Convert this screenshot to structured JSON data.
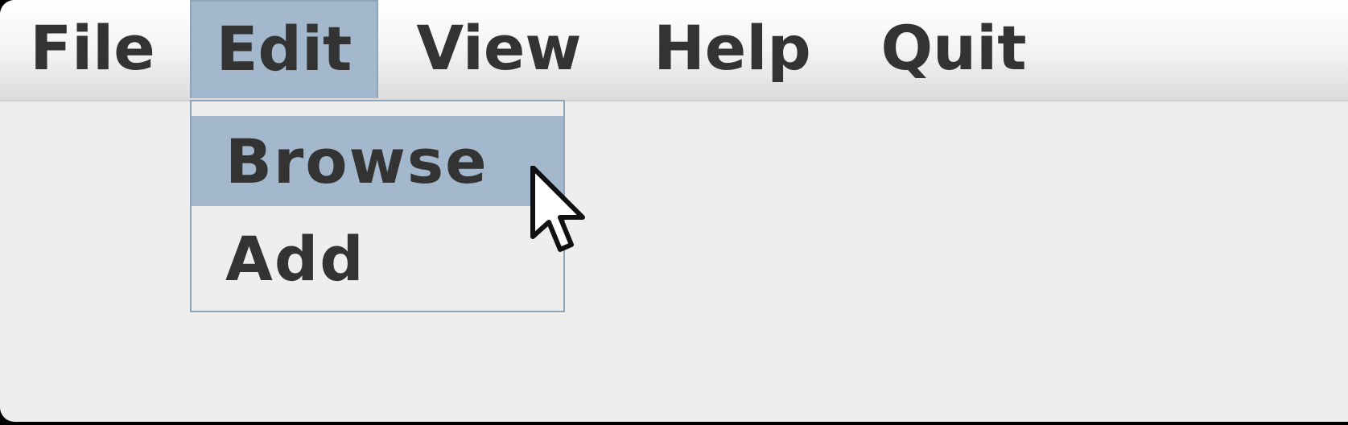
{
  "menubar": {
    "items": [
      {
        "label": "File"
      },
      {
        "label": "Edit"
      },
      {
        "label": "View"
      },
      {
        "label": "Help"
      },
      {
        "label": "Quit"
      }
    ],
    "active": "Edit"
  },
  "dropdown": {
    "items": [
      {
        "label": "Browse",
        "highlighted": true
      },
      {
        "label": "Add",
        "highlighted": false
      }
    ]
  },
  "colors": {
    "highlight": "#a3b8cc",
    "border": "#8fa4b8",
    "text": "#333333",
    "background": "#eeeeee"
  },
  "icons": {
    "cursor": "mouse-pointer-icon"
  }
}
